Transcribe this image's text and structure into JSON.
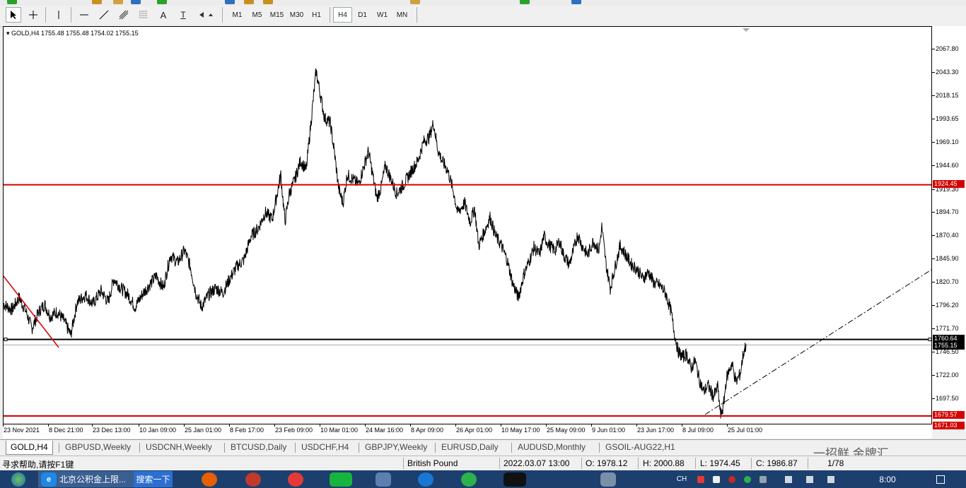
{
  "toolbar": {
    "timeframes": [
      "M1",
      "M5",
      "M15",
      "M30",
      "H1",
      "H4",
      "D1",
      "W1",
      "MN"
    ],
    "active_timeframe": "H4",
    "tools": [
      "cursor-icon",
      "crosshair-icon",
      "vertical-line-icon",
      "horizontal-line-icon",
      "trendline-icon",
      "channel-icon",
      "fibonacci-icon",
      "text-icon",
      "text-label-icon",
      "arrows-icon"
    ],
    "tool_glyphs": {
      "text": "A",
      "label": "T"
    }
  },
  "chart": {
    "header": "GOLD,H4  1755.48 1755.48 1754.02 1755.15",
    "price_labels": [
      "2067.80",
      "2043.30",
      "2018.15",
      "1993.65",
      "1969.10",
      "1944.60",
      "1919.30",
      "1894.70",
      "1870.40",
      "1845.90",
      "1820.70",
      "1796.20",
      "1771.70",
      "1746.50",
      "1722.00",
      "1697.50"
    ],
    "price_markers": [
      {
        "price": "1924.45",
        "color": "#d40000"
      },
      {
        "price": "1760.64",
        "color": "#000000"
      },
      {
        "price": "1755.15",
        "color": "#000000"
      },
      {
        "price": "1679.57",
        "color": "#d40000"
      },
      {
        "price": "1671.03",
        "color": "#d40000"
      }
    ],
    "time_labels": [
      "23 Nov 2021",
      "8 Dec 21:00",
      "23 Dec 13:00",
      "10 Jan 09:00",
      "25 Jan 01:00",
      "8 Feb 17:00",
      "23 Feb 09:00",
      "10 Mar 01:00",
      "24 Mar 16:00",
      "8 Apr 09:00",
      "26 Apr 01:00",
      "10 May 17:00",
      "25 May 09:00",
      "9 Jun 01:00",
      "23 Jun 17:00",
      "8 Jul 09:00",
      "25 Jul 01:00"
    ],
    "colors": {
      "support_resistance": "#d40000",
      "line": "#000000",
      "background": "#ffffff"
    }
  },
  "tabs": [
    "GOLD,H4",
    "GBPUSD,Weekly",
    "USDCNH,Weekly",
    "BTCUSD,Daily",
    "USDCHF,H4",
    "GBPJPY,Weekly",
    "EURUSD,Daily",
    "AUDUSD,Monthly",
    "GSOIL-AUG22,H1"
  ],
  "active_tab": "GOLD,H4",
  "status": {
    "help": "寻求帮助,请按F1键",
    "profile": "British Pound",
    "datetime": "2022.03.07 13:00",
    "open": "O: 1978.12",
    "high": "H: 2000.88",
    "low": "L: 1974.45",
    "close": "C: 1986.87",
    "extra": "1/78"
  },
  "watermark": "一招鲜 金牌汇",
  "taskbar": {
    "items": [
      "北京公积金上限...",
      "搜索一下"
    ],
    "clock": "8:00",
    "tray_text": "CH"
  }
}
